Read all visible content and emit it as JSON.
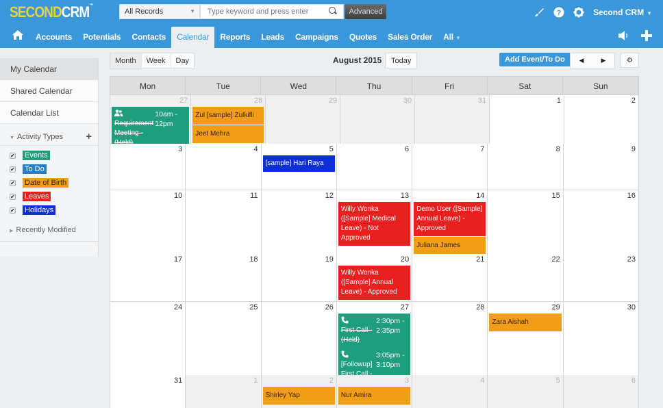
{
  "app": {
    "logo_part1": "SECOND",
    "logo_part2": "CRM",
    "logo_tm": "™"
  },
  "search": {
    "scope": "All Records",
    "placeholder": "Type keyword and press enter",
    "advanced_label": "Advanced"
  },
  "user_menu": {
    "label": "Second CRM"
  },
  "nav": {
    "items": [
      "Accounts",
      "Potentials",
      "Contacts",
      "Calendar",
      "Reports",
      "Leads",
      "Campaigns",
      "Quotes",
      "Sales Order"
    ],
    "active": "Calendar",
    "all_label": "All"
  },
  "sidebar": {
    "items": [
      "My Calendar",
      "Shared Calendar",
      "Calendar List"
    ],
    "active": "My Calendar",
    "activity_types_label": "Activity Types",
    "activity_types": [
      {
        "label": "Events",
        "color": "#1e9e7c",
        "checked": true
      },
      {
        "label": "To Do",
        "color": "#2b7fc1",
        "checked": true
      },
      {
        "label": "Date of Birth",
        "color": "#f19d18",
        "checked": true
      },
      {
        "label": "Leaves",
        "color": "#e8201f",
        "checked": true
      },
      {
        "label": "Holidays",
        "color": "#0c2fd8",
        "checked": true
      }
    ],
    "recently_modified_label": "Recently Modified"
  },
  "toolbar": {
    "views": [
      "Month",
      "Week",
      "Day"
    ],
    "active_view": "Month",
    "month_title": "August 2015",
    "today_label": "Today",
    "add_label": "Add Event/To Do",
    "prev": "◀",
    "next": "▶",
    "settings": "⚙"
  },
  "calendar": {
    "weekdays": [
      "Mon",
      "Tue",
      "Wed",
      "Thu",
      "Fri",
      "Sat",
      "Sun"
    ],
    "weeks": [
      {
        "days": [
          {
            "num": "27",
            "other": true,
            "events": [
              {
                "type": "green",
                "icon": "group",
                "title": "Requirement Meeting - (Held)",
                "strike": true,
                "time": "10am - 12pm"
              }
            ]
          },
          {
            "num": "28",
            "other": true,
            "events": [
              {
                "type": "orange",
                "title": "Zul [sample] Zulkifli"
              },
              {
                "type": "orange",
                "title": "Jeet Mehra"
              }
            ]
          },
          {
            "num": "29",
            "other": true,
            "events": []
          },
          {
            "num": "30",
            "other": true,
            "events": []
          },
          {
            "num": "31",
            "other": true,
            "events": []
          },
          {
            "num": "1",
            "other": false,
            "events": []
          },
          {
            "num": "2",
            "other": false,
            "events": []
          }
        ]
      },
      {
        "days": [
          {
            "num": "3",
            "other": false,
            "events": []
          },
          {
            "num": "4",
            "other": false,
            "events": []
          },
          {
            "num": "5",
            "other": false,
            "events": [
              {
                "type": "blue",
                "title": "[sample] Hari Raya"
              }
            ]
          },
          {
            "num": "6",
            "other": false,
            "events": []
          },
          {
            "num": "7",
            "other": false,
            "events": []
          },
          {
            "num": "8",
            "other": false,
            "events": []
          },
          {
            "num": "9",
            "other": false,
            "events": []
          }
        ]
      },
      {
        "days": [
          {
            "num": "10",
            "other": false,
            "events": []
          },
          {
            "num": "11",
            "other": false,
            "events": []
          },
          {
            "num": "12",
            "other": false,
            "events": []
          },
          {
            "num": "13",
            "other": false,
            "events": [
              {
                "type": "red",
                "title": "Willy Wonka ([Sample] Medical Leave) - Not Approved"
              }
            ]
          },
          {
            "num": "14",
            "other": false,
            "events": [
              {
                "type": "red",
                "title": "Demo User ([Sample] Annual Leave) - Approved"
              },
              {
                "type": "orange",
                "title": "Juliana James"
              }
            ]
          },
          {
            "num": "15",
            "other": false,
            "events": []
          },
          {
            "num": "16",
            "other": false,
            "events": []
          }
        ]
      },
      {
        "days": [
          {
            "num": "17",
            "other": false,
            "events": []
          },
          {
            "num": "18",
            "other": false,
            "events": []
          },
          {
            "num": "19",
            "other": false,
            "events": []
          },
          {
            "num": "20",
            "other": false,
            "events": [
              {
                "type": "red",
                "title": "Willy Wonka ([Sample] Annual Leave) - Approved"
              }
            ]
          },
          {
            "num": "21",
            "other": false,
            "events": []
          },
          {
            "num": "22",
            "other": false,
            "events": []
          },
          {
            "num": "23",
            "other": false,
            "events": []
          }
        ]
      },
      {
        "days": [
          {
            "num": "24",
            "other": false,
            "events": []
          },
          {
            "num": "25",
            "other": false,
            "events": []
          },
          {
            "num": "26",
            "other": false,
            "events": []
          },
          {
            "num": "27",
            "other": false,
            "events": [
              {
                "type": "green",
                "icon": "phone",
                "title": "First Call - (Held)",
                "strike": true,
                "time": "2:30pm - 2:35pm"
              },
              {
                "type": "green",
                "icon": "phone",
                "title": "[Followup] First Call - (Planned)",
                "strike": false,
                "time": "3:05pm - 3:10pm"
              }
            ]
          },
          {
            "num": "28",
            "other": false,
            "events": []
          },
          {
            "num": "29",
            "other": false,
            "events": [
              {
                "type": "orange",
                "title": "Zara Aishah"
              }
            ]
          },
          {
            "num": "30",
            "other": false,
            "events": []
          }
        ]
      },
      {
        "days": [
          {
            "num": "31",
            "other": false,
            "events": []
          },
          {
            "num": "1",
            "other": true,
            "events": []
          },
          {
            "num": "2",
            "other": true,
            "events": [
              {
                "type": "orange",
                "title": "Shirley Yap"
              }
            ]
          },
          {
            "num": "3",
            "other": true,
            "events": [
              {
                "type": "orange",
                "title": "Nur Amira"
              }
            ]
          },
          {
            "num": "4",
            "other": true,
            "events": []
          },
          {
            "num": "5",
            "other": true,
            "events": []
          },
          {
            "num": "6",
            "other": true,
            "events": []
          }
        ]
      }
    ]
  }
}
